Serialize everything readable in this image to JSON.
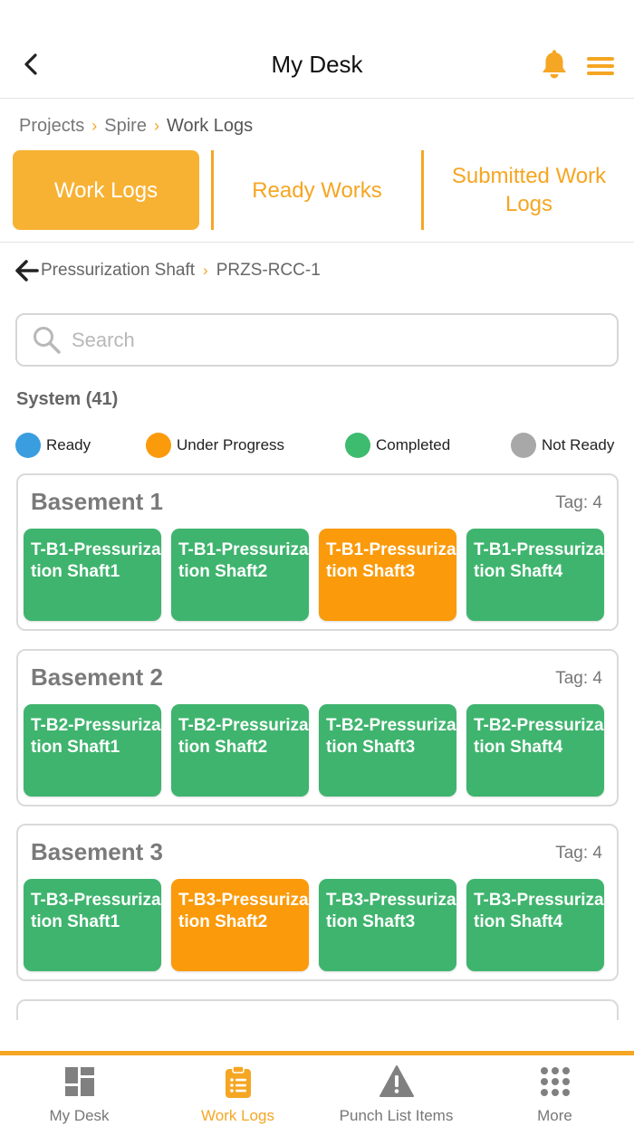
{
  "header": {
    "title": "My Desk"
  },
  "breadcrumb": {
    "items": [
      "Projects",
      "Spire",
      "Work Logs"
    ]
  },
  "tabs": [
    {
      "label": "Work Logs",
      "active": true
    },
    {
      "label": "Ready Works",
      "active": false
    },
    {
      "label": "Submitted Work Logs",
      "active": false
    }
  ],
  "sub_breadcrumb": {
    "items": [
      "Pressurization Shaft",
      "PRZS-RCC-1"
    ]
  },
  "search": {
    "placeholder": "Search",
    "value": ""
  },
  "system_count": "System (41)",
  "legend": [
    {
      "label": "Ready",
      "color": "#3a9de0"
    },
    {
      "label": "Under Progress",
      "color": "#fb9a0a"
    },
    {
      "label": "Completed",
      "color": "#3dbb6f"
    },
    {
      "label": "Not Ready",
      "color": "#a8a8a8"
    }
  ],
  "status_colors": {
    "completed": "#3fb46e",
    "under_progress": "#fb9a0a"
  },
  "groups": [
    {
      "title": "Basement 1",
      "tag": "Tag: 4",
      "items": [
        {
          "label": "T-B1-Pressurization Shaft1",
          "status": "completed"
        },
        {
          "label": "T-B1-Pressurization Shaft2",
          "status": "completed"
        },
        {
          "label": "T-B1-Pressurization Shaft3",
          "status": "under_progress"
        },
        {
          "label": "T-B1-Pressurization Shaft4",
          "status": "completed"
        }
      ]
    },
    {
      "title": "Basement 2",
      "tag": "Tag: 4",
      "items": [
        {
          "label": "T-B2-Pressurization Shaft1",
          "status": "completed"
        },
        {
          "label": "T-B2-Pressurization Shaft2",
          "status": "completed"
        },
        {
          "label": "T-B2-Pressurization Shaft3",
          "status": "completed"
        },
        {
          "label": "T-B2-Pressurization Shaft4",
          "status": "completed"
        }
      ]
    },
    {
      "title": "Basement 3",
      "tag": "Tag: 4",
      "items": [
        {
          "label": "T-B3-Pressurization Shaft1",
          "status": "completed"
        },
        {
          "label": "T-B3-Pressurization Shaft2",
          "status": "under_progress"
        },
        {
          "label": "T-B3-Pressurization Shaft3",
          "status": "completed"
        },
        {
          "label": "T-B3-Pressurization Shaft4",
          "status": "completed"
        }
      ]
    }
  ],
  "bottom_nav": [
    {
      "label": "My Desk",
      "icon": "dashboard-icon",
      "active": false
    },
    {
      "label": "Work Logs",
      "icon": "clipboard-list-icon",
      "active": true
    },
    {
      "label": "Punch List Items",
      "icon": "warning-icon",
      "active": false
    },
    {
      "label": "More",
      "icon": "grid-dots-icon",
      "active": false
    }
  ]
}
